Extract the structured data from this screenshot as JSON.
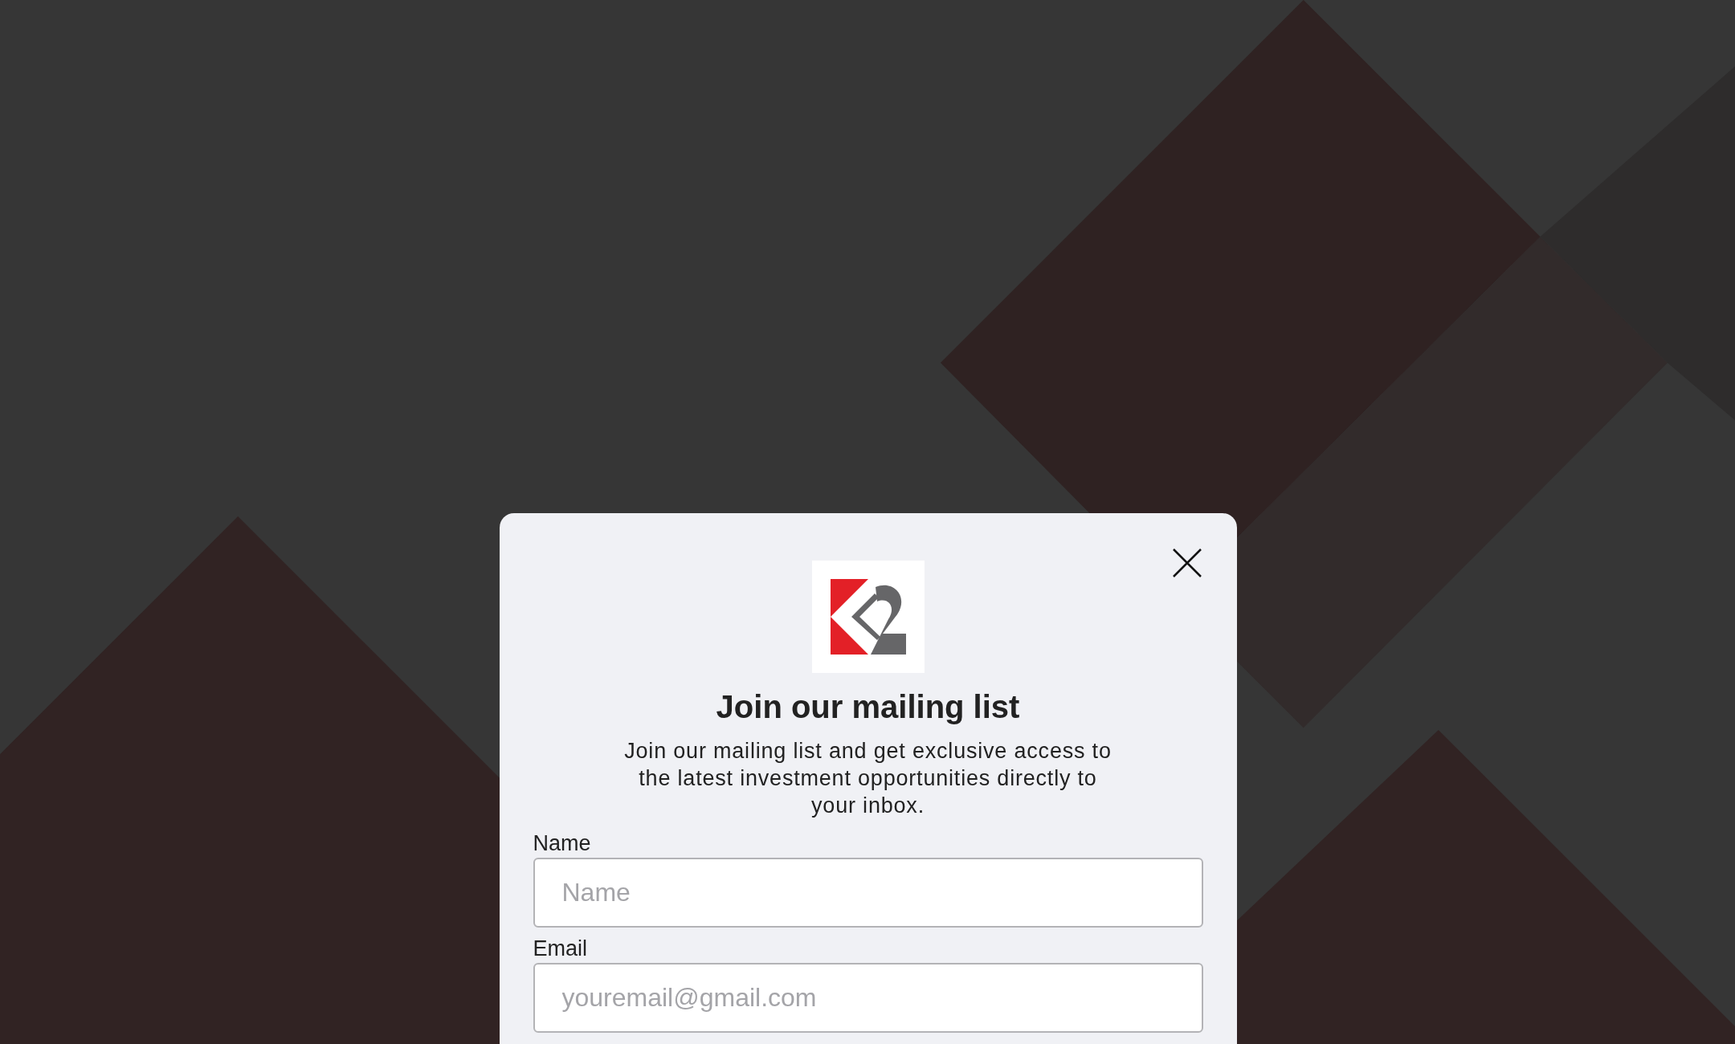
{
  "dialog": {
    "title": "Join our mailing list",
    "description": "Join our mailing list and get exclusive access to the latest investment opportunities directly to your inbox.",
    "fields": [
      {
        "label": "Name",
        "placeholder": "Name"
      },
      {
        "label": "Email",
        "placeholder": "youremail@gmail.com"
      }
    ]
  }
}
